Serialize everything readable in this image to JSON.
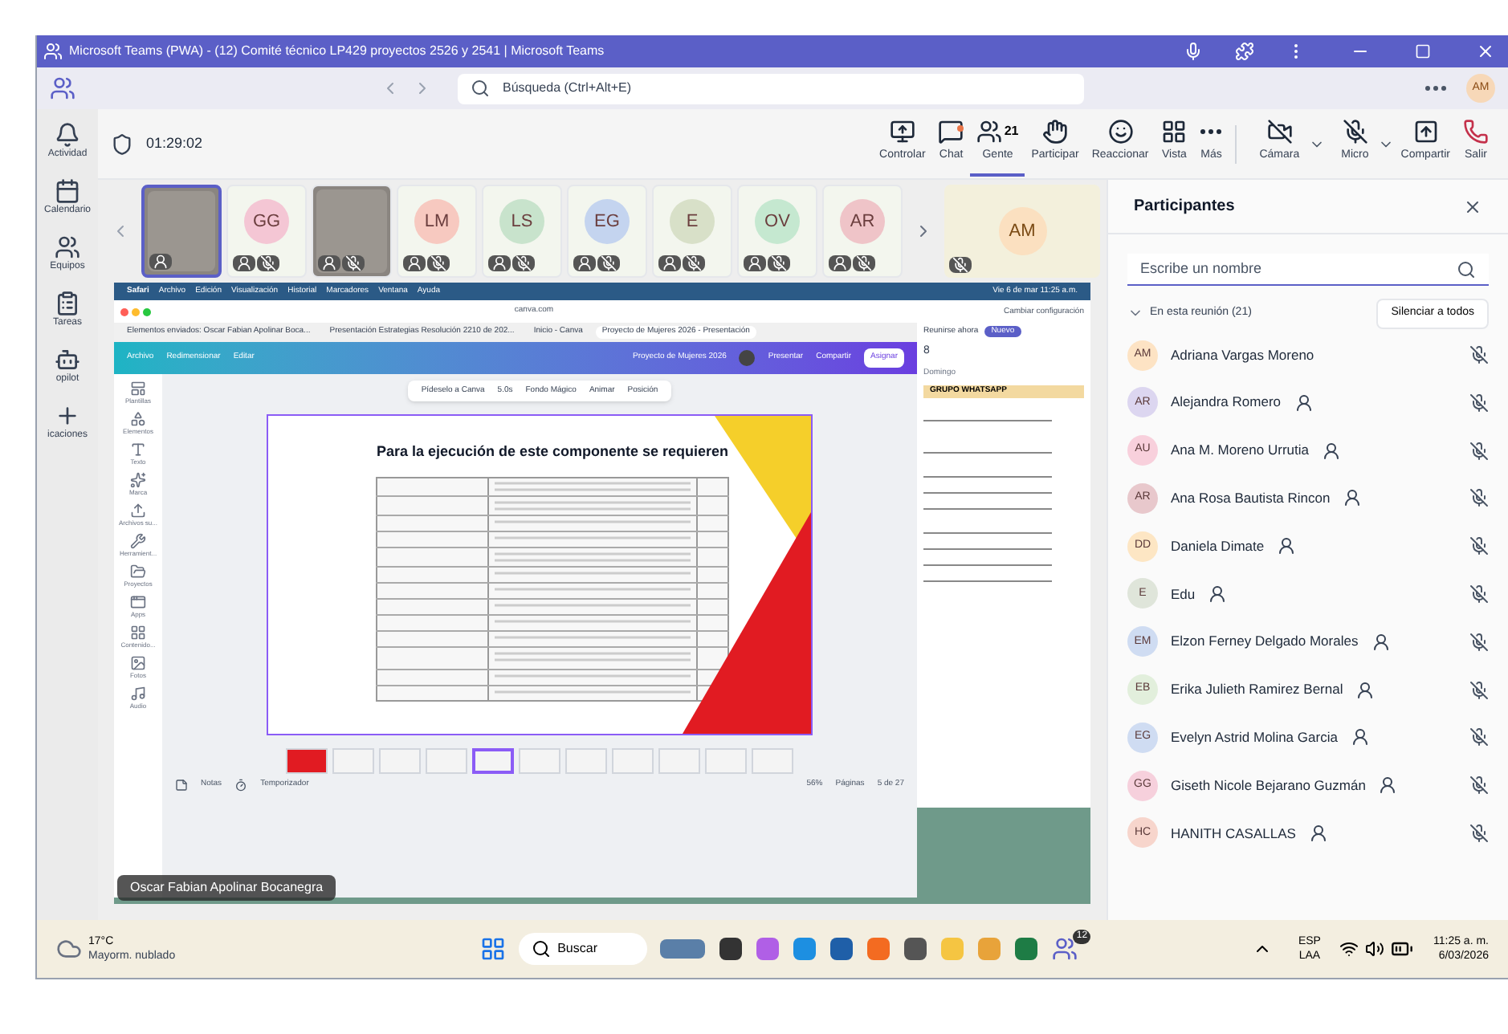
{
  "window": {
    "title": "Microsoft Teams (PWA) - (12) Comité técnico LP429 proyectos 2526 y 2541 | Microsoft Teams"
  },
  "search": {
    "placeholder": "Búsqueda (Ctrl+Alt+E)"
  },
  "user": {
    "initials": "AM"
  },
  "sidebar": {
    "items": [
      {
        "label": "Actividad"
      },
      {
        "label": "Calendario"
      },
      {
        "label": "Equipos"
      },
      {
        "label": "Tareas"
      },
      {
        "label": "opilot"
      },
      {
        "label": "icaciones"
      }
    ]
  },
  "meeting": {
    "timer": "01:29:02",
    "toolbar": [
      {
        "label": "Controlar",
        "kind": "action",
        "selected": false,
        "badge": false
      },
      {
        "label": "Chat",
        "kind": "action",
        "selected": false,
        "badge": true
      },
      {
        "label": "Gente",
        "kind": "action",
        "selected": true,
        "badge": false,
        "count": "21"
      },
      {
        "label": "Participar",
        "kind": "action",
        "selected": false,
        "badge": false
      },
      {
        "label": "Reaccionar",
        "kind": "action",
        "selected": false,
        "badge": false
      },
      {
        "label": "Vista",
        "kind": "action",
        "selected": false,
        "badge": false
      },
      {
        "label": "Más",
        "kind": "action",
        "selected": false,
        "badge": false
      },
      {
        "label": "Cámara",
        "kind": "device",
        "selected": false,
        "badge": false
      },
      {
        "label": "Micro",
        "kind": "device",
        "selected": false,
        "badge": false
      },
      {
        "label": "Compartir",
        "kind": "action",
        "selected": false,
        "badge": false
      },
      {
        "label": "Salir",
        "kind": "leave",
        "selected": false,
        "badge": false
      }
    ]
  },
  "thumbnails": [
    {
      "kind": "video",
      "selected": true,
      "guest": true,
      "muted": false
    },
    {
      "kind": "avatar",
      "initials": "GG",
      "color": "#f4c6d4",
      "selected": false,
      "guest": true,
      "muted": true
    },
    {
      "kind": "video",
      "selected": false,
      "guest": true,
      "muted": true
    },
    {
      "kind": "avatar",
      "initials": "LM",
      "color": "#f7c9c0",
      "selected": false,
      "guest": true,
      "muted": true
    },
    {
      "kind": "avatar",
      "initials": "LS",
      "color": "#c8e3cc",
      "selected": false,
      "guest": true,
      "muted": true
    },
    {
      "kind": "avatar",
      "initials": "EG",
      "color": "#c4d4ef",
      "selected": false,
      "guest": true,
      "muted": true
    },
    {
      "kind": "avatar",
      "initials": "E",
      "color": "#d8e0c8",
      "selected": false,
      "guest": true,
      "muted": true
    },
    {
      "kind": "avatar",
      "initials": "OV",
      "color": "#c5e8d0",
      "selected": false,
      "guest": true,
      "muted": true
    },
    {
      "kind": "avatar",
      "initials": "AR",
      "color": "#efc4c8",
      "selected": false,
      "guest": true,
      "muted": true
    }
  ],
  "featured_tile": {
    "initials": "AM",
    "color": "#fbe0c0",
    "muted": true
  },
  "shared_screen": {
    "menu_bar": [
      "Safari",
      "Archivo",
      "Edición",
      "Visualización",
      "Historial",
      "Marcadores",
      "Ventana",
      "Ayuda"
    ],
    "clock": "Vie 6 de mar  11:25 a.m.",
    "url": "canva.com",
    "tabs": [
      {
        "label": "Elementos enviados: Oscar Fabian Apolinar Boca...",
        "selected": false
      },
      {
        "label": "Presentación Estrategias Resolución 2210 de 202...",
        "selected": false
      },
      {
        "label": "Inicio - Canva",
        "selected": false
      },
      {
        "label": "Proyecto de Mujeres 2026 - Presentación",
        "selected": true
      }
    ],
    "canva_menu": [
      "Archivo",
      "Redimensionar",
      "Editar"
    ],
    "project_title": "Proyecto de Mujeres 2026",
    "present": "Presentar",
    "share": "Compartir",
    "assign": "Asignar",
    "side_tools": [
      "Plantillas",
      "Elementos",
      "Texto",
      "Marca",
      "Archivos su...",
      "Herramient...",
      "Proyectos",
      "Apps",
      "Contenido...",
      "Fotos",
      "Audio"
    ],
    "slide_tools": [
      {
        "label": "Pídeselo a Canva"
      },
      {
        "label": "5.0s"
      },
      {
        "label": "Fondo Mágico"
      },
      {
        "label": "Animar"
      },
      {
        "label": "Posición"
      }
    ],
    "slide_title": "Para la ejecución de este componente se requieren",
    "pages": [
      {
        "selected": false
      },
      {
        "selected": false
      },
      {
        "selected": false
      },
      {
        "selected": false
      },
      {
        "selected": true
      },
      {
        "selected": false
      },
      {
        "selected": false
      },
      {
        "selected": false
      },
      {
        "selected": false
      },
      {
        "selected": false
      },
      {
        "selected": false
      }
    ],
    "notes": "Notas",
    "timer": "Temporizador",
    "zoom": "56%",
    "pages_label": "Páginas",
    "page_count": "5 de 27",
    "calendar": {
      "settings": "Cambiar configuración",
      "meet_now": "Reunirse ahora",
      "new": "Nuevo",
      "day_number": "8",
      "day_name": "Domingo",
      "column_header": "GRUPO WHATSAPP"
    },
    "presenter": "Oscar Fabian Apolinar Bocanegra"
  },
  "participants": {
    "title": "Participantes",
    "search_placeholder": "Escribe un nombre",
    "section": "En esta reunión (21)",
    "mute_all": "Silenciar a todos",
    "people": [
      {
        "initials": "AM",
        "name": "Adriana Vargas Moreno",
        "color": "#fde3c4",
        "guest": false
      },
      {
        "initials": "AR",
        "name": "Alejandra Romero",
        "color": "#dcd6f0",
        "guest": true
      },
      {
        "initials": "AU",
        "name": "Ana M. Moreno Urrutia",
        "color": "#f8d0dc",
        "guest": true
      },
      {
        "initials": "AR",
        "name": "Ana Rosa Bautista Rincon",
        "color": "#e8c8cc",
        "guest": true
      },
      {
        "initials": "DD",
        "name": "Daniela Dimate",
        "color": "#fde6c4",
        "guest": true
      },
      {
        "initials": "E",
        "name": "Edu",
        "color": "#dfe5da",
        "guest": true
      },
      {
        "initials": "EM",
        "name": "Elzon Ferney Delgado Morales",
        "color": "#cfdcf2",
        "guest": true
      },
      {
        "initials": "EB",
        "name": "Erika Julieth Ramirez Bernal",
        "color": "#e2efdc",
        "guest": true
      },
      {
        "initials": "EG",
        "name": "Evelyn Astrid Molina Garcia",
        "color": "#cfdcf2",
        "guest": true
      },
      {
        "initials": "GG",
        "name": "Giseth Nicole Bejarano Guzmán",
        "color": "#f6d0dc",
        "guest": true
      },
      {
        "initials": "HC",
        "name": "HANITH CASALLAS",
        "color": "#f7d5cc",
        "guest": true
      }
    ]
  },
  "taskbar": {
    "temperature": "17°C",
    "weather": "Mayorm. nublado",
    "search": "Buscar",
    "teams_badge": "12",
    "language": "ESP",
    "layout": "LAA",
    "time": "11:25 a. m.",
    "date": "6/03/2026"
  }
}
